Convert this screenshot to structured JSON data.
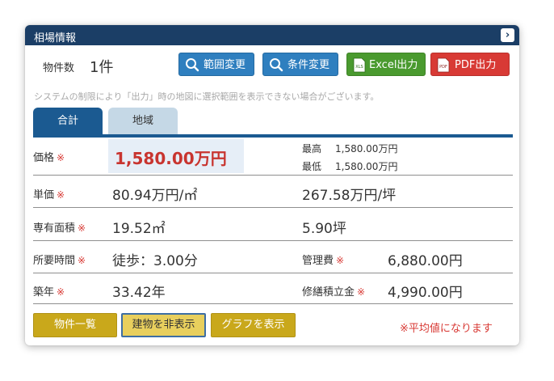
{
  "panel": {
    "title": "相場情報"
  },
  "summary": {
    "count_label": "物件数",
    "count_value": "1件"
  },
  "toolbar": {
    "range_change": "範囲変更",
    "condition_change": "条件変更",
    "excel": "Excel出力",
    "pdf": "PDF出力",
    "excel_icon_text": "XLS",
    "pdf_icon_text": "PDF"
  },
  "notice": "システムの制限により「出力」時の地図に選択範囲を表示できない場合がございます。",
  "tabs": {
    "total": "合計",
    "area": "地域"
  },
  "required_mark": "※",
  "rows": {
    "price": {
      "label": "価格",
      "value": "1,580.00万円",
      "max_label": "最高",
      "max_value": "1,580.00万円",
      "min_label": "最低",
      "min_value": "1,580.00万円"
    },
    "unit_price": {
      "label": "単価",
      "value_sqm": "80.94万円/㎡",
      "value_tsubo": "267.58万円/坪"
    },
    "area": {
      "label": "専有面積",
      "value_sqm": "19.52㎡",
      "value_tsubo": "5.90坪"
    },
    "time": {
      "label": "所要時間",
      "value": "徒歩：3.00分",
      "mgmt_label": "管理費",
      "mgmt_value": "6,880.00円"
    },
    "age": {
      "label": "築年",
      "value": "33.42年",
      "repair_label": "修繕積立金",
      "repair_value": "4,990.00円"
    }
  },
  "buttons": {
    "list": "物件一覧",
    "hide_buildings": "建物を非表示",
    "show_graph": "グラフを表示"
  },
  "footnote": "※平均値になります",
  "colors": {
    "header": "#1b3e66",
    "accent_blue": "#1b5a91",
    "button_blue": "#2f7fbf",
    "excel_green": "#4a9a2f",
    "pdf_red": "#d83a35",
    "gold": "#c9a81b",
    "price_red": "#c8342f"
  }
}
